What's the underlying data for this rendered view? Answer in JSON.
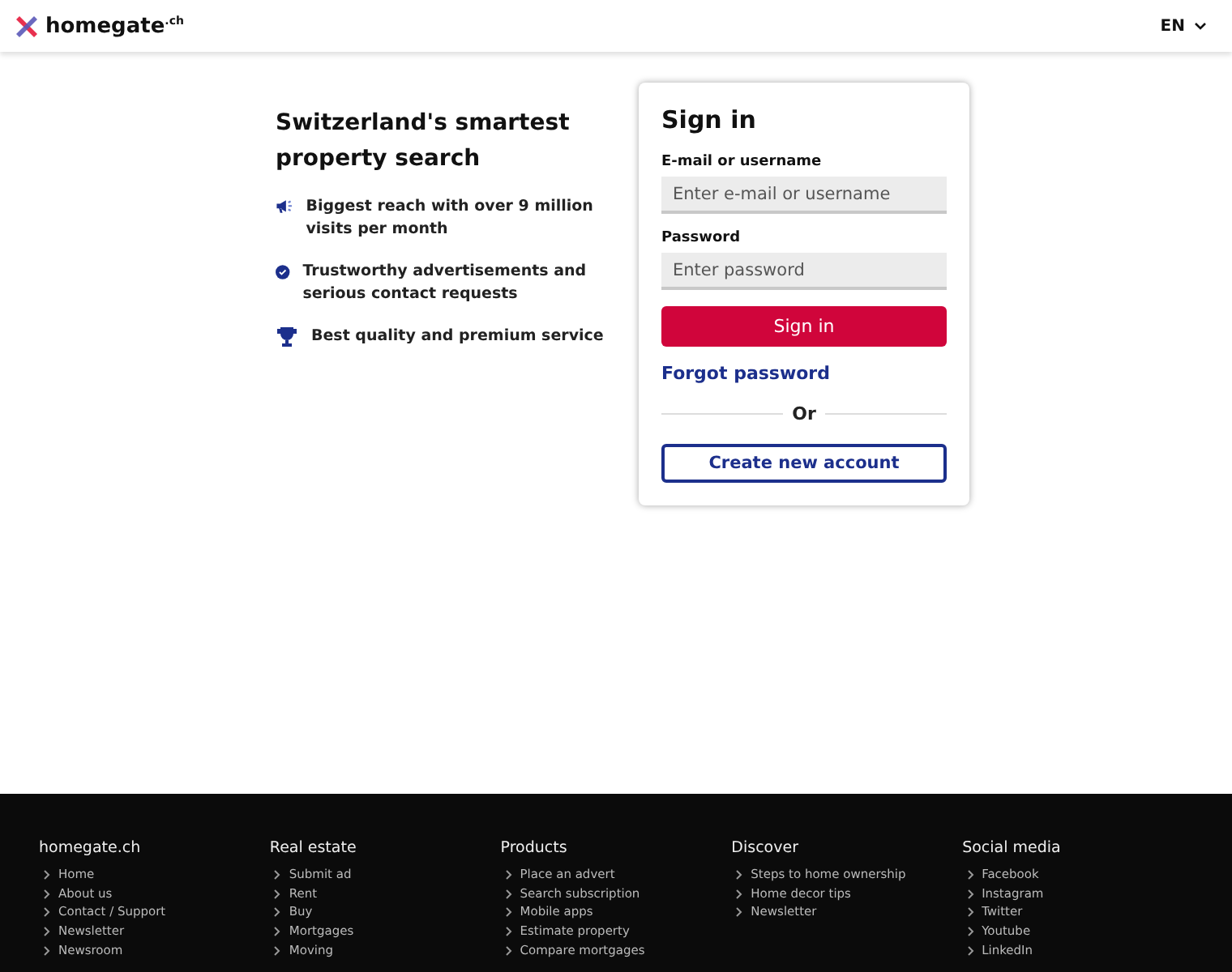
{
  "header": {
    "logo": "homegate",
    "logo_suffix": ".ch",
    "language": "EN"
  },
  "intro": {
    "title": "Switzerland's smartest property search",
    "features": [
      {
        "kind": "megaphone",
        "text": "Biggest reach with over 9 million visits per month"
      },
      {
        "kind": "badge",
        "text": "Trustworthy advertisements and serious contact requests"
      },
      {
        "kind": "trophy",
        "text": "Best quality and premium service"
      }
    ]
  },
  "signin": {
    "title": "Sign in",
    "fields": [
      {
        "label": "E-mail or username",
        "placeholder": "Enter e-mail or username"
      },
      {
        "label": "Password",
        "placeholder": "Enter password"
      }
    ],
    "submit": "Sign in",
    "forgot": "Forgot password",
    "divider": "Or",
    "create": "Create new account"
  },
  "footer": {
    "columns": [
      {
        "title": "homegate.ch",
        "links": [
          "Home",
          "About us",
          "Contact / Support",
          "Newsletter",
          "Newsroom"
        ]
      },
      {
        "title": "Real estate",
        "links": [
          "Submit ad",
          "Rent",
          "Buy",
          "Mortgages",
          "Moving"
        ]
      },
      {
        "title": "Products",
        "links": [
          "Place an advert",
          "Search subscription",
          "Mobile apps",
          "Estimate property",
          "Compare mortgages"
        ]
      },
      {
        "title": "Discover",
        "links": [
          "Steps to home ownership",
          "Home decor tips",
          "Newsletter"
        ]
      },
      {
        "title": "Social media",
        "links": [
          "Facebook",
          "Instagram",
          "Twitter",
          "Youtube",
          "LinkedIn"
        ]
      }
    ]
  }
}
